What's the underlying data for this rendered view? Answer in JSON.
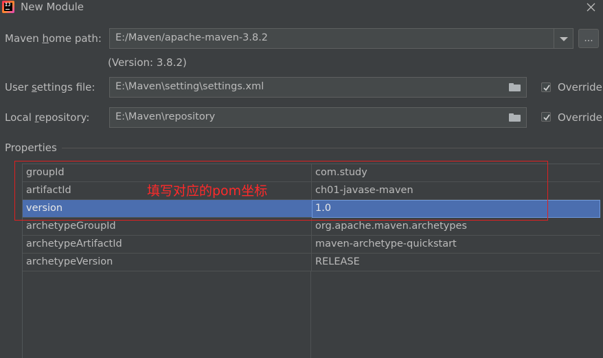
{
  "window": {
    "title": "New Module"
  },
  "maven": {
    "home_label_pre": "Maven ",
    "home_label_mnemonic": "h",
    "home_label_post": "ome path:",
    "home_value": "E:/Maven/apache-maven-3.8.2",
    "browse_label": "...",
    "version_note": "(Version: 3.8.2)",
    "settings_label_pre": "User ",
    "settings_label_mnemonic": "s",
    "settings_label_post": "ettings file:",
    "settings_value": "E:\\Maven\\setting\\settings.xml",
    "settings_override_label": "Override",
    "settings_override_checked": true,
    "repo_label_pre": "Local ",
    "repo_label_mnemonic": "r",
    "repo_label_post": "epository:",
    "repo_value": "E:\\Maven\\repository",
    "repo_override_label": "Override",
    "repo_override_checked": true
  },
  "properties": {
    "section_title": "Properties",
    "rows": [
      {
        "key": "groupId",
        "value": "com.study"
      },
      {
        "key": "artifactId",
        "value": "ch01-javase-maven"
      },
      {
        "key": "version",
        "value": "1.0"
      },
      {
        "key": "archetypeGroupId",
        "value": "org.apache.maven.archetypes"
      },
      {
        "key": "archetypeArtifactId",
        "value": "maven-archetype-quickstart"
      },
      {
        "key": "archetypeVersion",
        "value": "RELEASE"
      }
    ],
    "selected_row": "version"
  },
  "annotation": {
    "text": "填写对应的pom坐标",
    "color": "#e02020"
  },
  "colors": {
    "background": "#3c3f41",
    "selection": "#4b6eaf",
    "text": "#bbbbbb"
  }
}
